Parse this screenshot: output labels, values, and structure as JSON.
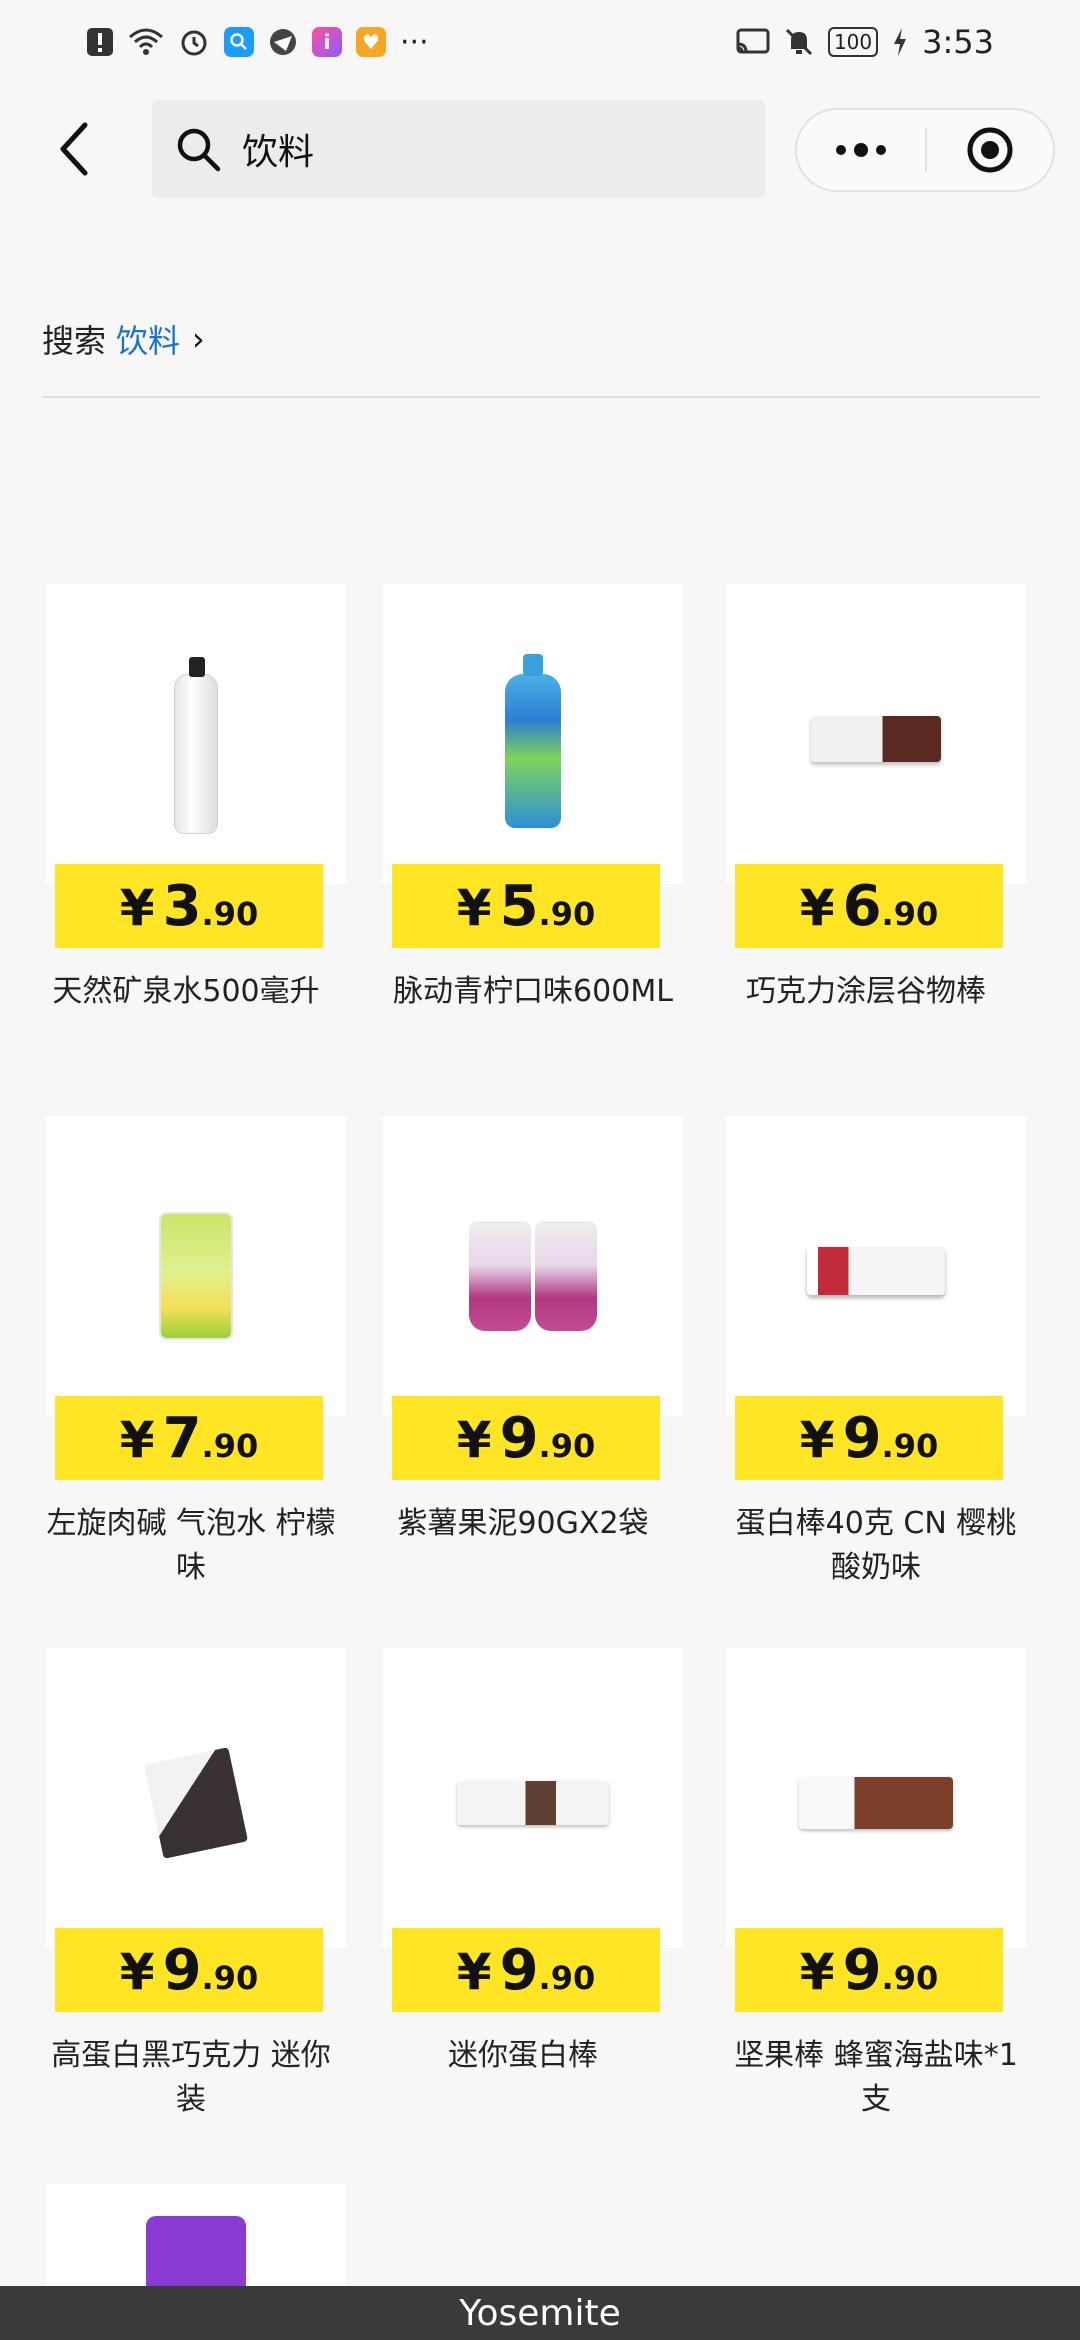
{
  "status_bar": {
    "icons": [
      "alert-icon",
      "wifi-icon",
      "alarm-icon",
      "search-app-icon",
      "browser-icon",
      "app-i-icon",
      "app-heart-icon",
      "more-icon"
    ],
    "battery": "100",
    "time": "3:53"
  },
  "header": {
    "search_value": "饮料"
  },
  "breadcrumb": {
    "prefix": "搜索",
    "term": "饮料",
    "arrow": "›"
  },
  "products": [
    {
      "name": "天然矿泉水500毫升",
      "currency": "¥",
      "price_int": "3",
      "price_dec": ".90"
    },
    {
      "name": "脉动青柠口味600ML",
      "currency": "¥",
      "price_int": "5",
      "price_dec": ".90"
    },
    {
      "name": "巧克力涂层谷物棒",
      "currency": "¥",
      "price_int": "6",
      "price_dec": ".90"
    },
    {
      "name": "左旋肉碱 气泡水 柠檬味",
      "currency": "¥",
      "price_int": "7",
      "price_dec": ".90"
    },
    {
      "name": "紫薯果泥90GX2袋",
      "currency": "¥",
      "price_int": "9",
      "price_dec": ".90"
    },
    {
      "name": "蛋白棒40克 CN 樱桃酸奶味",
      "currency": "¥",
      "price_int": "9",
      "price_dec": ".90"
    },
    {
      "name": "高蛋白黑巧克力 迷你装",
      "currency": "¥",
      "price_int": "9",
      "price_dec": ".90"
    },
    {
      "name": "迷你蛋白棒",
      "currency": "¥",
      "price_int": "9",
      "price_dec": ".90"
    },
    {
      "name": "坚果棒 蜂蜜海盐味*1支",
      "currency": "¥",
      "price_int": "9",
      "price_dec": ".90"
    }
  ],
  "bottom_label": "Yosemite"
}
